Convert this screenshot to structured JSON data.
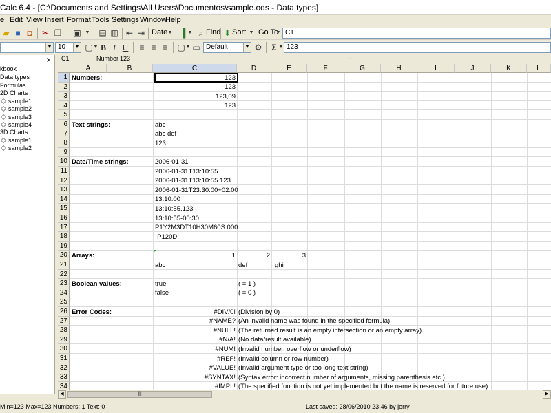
{
  "window": {
    "title": "Calc 6.4 - [C:\\Documents and Settings\\All Users\\Documentos\\sample.ods - Data types]"
  },
  "menu": [
    "e",
    "Edit",
    "View",
    "Insert",
    "Format",
    "Tools",
    "Settings",
    "Window",
    "Help"
  ],
  "toolbar1": {
    "date_label": "Date",
    "find_label": "Find",
    "sort_label": "Sort",
    "goto_label": "Go To",
    "goto_value": "C1"
  },
  "toolbar2": {
    "font_size": "10",
    "bold": "B",
    "italic": "I",
    "underline": "U",
    "style": "Default",
    "sigma": "Σ",
    "formula_value": "123"
  },
  "formula_bar": {
    "cell_ref": "C1",
    "type": "Number",
    "value": "123",
    "dash": "-"
  },
  "sidebar": {
    "close": "×",
    "items": [
      {
        "label": "kbook"
      },
      {
        "label": "Data types"
      },
      {
        "label": "Formulas"
      },
      {
        "label": "2D Charts"
      },
      {
        "label": "sample1"
      },
      {
        "label": "sample2"
      },
      {
        "label": "sample3"
      },
      {
        "label": "sample4"
      },
      {
        "label": "3D Charts"
      },
      {
        "label": "sample1"
      },
      {
        "label": "sample2"
      }
    ]
  },
  "columns": [
    "A",
    "B",
    "C",
    "D",
    "E",
    "F",
    "G",
    "H",
    "I",
    "J",
    "K",
    "L"
  ],
  "rows": [
    "1",
    "2",
    "3",
    "4",
    "5",
    "6",
    "7",
    "8",
    "9",
    "10",
    "11",
    "12",
    "13",
    "14",
    "15",
    "16",
    "17",
    "18",
    "19",
    "20",
    "21",
    "22",
    "23",
    "24",
    "25",
    "26",
    "27",
    "28",
    "29",
    "30",
    "31",
    "32",
    "33",
    "34"
  ],
  "cells": {
    "a1": "Numbers:",
    "c1": "123",
    "c2": "-123",
    "c3": "123,09",
    "c4": "123",
    "a6": "Text strings:",
    "c6": "abc",
    "c7": "abc def",
    "c8": "123",
    "a10": "Date/Time strings:",
    "c10": "2006-01-31",
    "c11": "2006-01-31T13:10:55",
    "c12": "2006-01-31T13:10:55.123",
    "c13": "2006-01-31T23:30:00+02:00",
    "c14": "13:10:00",
    "c15": "13:10:55.123",
    "c16": "13:10:55-00:30",
    "c17": "P1Y2M3DT10H30M60S.000",
    "c18": "-P120D",
    "a20": "Arrays:",
    "c20": "1",
    "d20": "2",
    "e20": "3",
    "c21": "abc",
    "d21": "def",
    "e21": "ghi",
    "a23": "Boolean values:",
    "c23": "true",
    "d23": "( = 1 )",
    "c24": "false",
    "d24": "( = 0 )",
    "a26": "Error Codes:",
    "c26": "#DIV/0!",
    "d26": "(Division by 0)",
    "c27": "#NAME?",
    "d27": "(An invalid name was found in the specified formula)",
    "c28": "#NULL!",
    "d28": "(The returned result is an empty intersection or an empty array)",
    "c29": "#N/A!",
    "d29": "(No data/result available)",
    "c30": "#NUM!",
    "d30": "(Invalid number, overflow or underflow)",
    "c31": "#REF!",
    "d31": "(Invalid column or row number)",
    "c32": "#VALUE!",
    "d32": "(Invalid argument type or too long text string)",
    "c33": "#SYNTAX!",
    "d33": "(Syntax error: incorrect number of arguments, missing parenthesis etc.)",
    "c34": "#IMPL!",
    "d34": "(The specified function is not yet implemented but the name is reserved for future use)"
  },
  "status": {
    "left": "Min=123  Max=123  Numbers: 1  Text: 0",
    "saved": "Last saved:  28/06/2010 23:46  by  jerry"
  }
}
